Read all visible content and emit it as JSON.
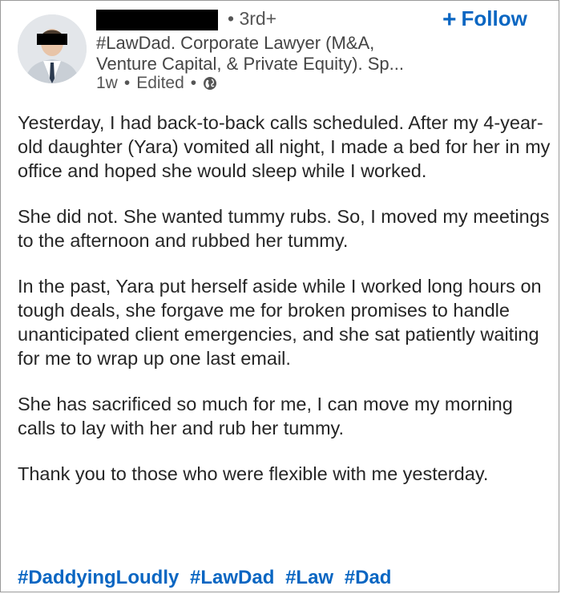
{
  "post": {
    "degree": "• 3rd+",
    "follow_label": "Follow",
    "headline_line1": "#LawDad. Corporate Lawyer (M&A,",
    "headline_line2": "Venture Capital, & Private Equity). Sp...",
    "time": "1w",
    "edited": "Edited",
    "paragraphs": [
      "Yesterday, I had back-to-back calls scheduled. After my 4-year-old daughter (Yara) vomited all night, I made a bed for her in my office and hoped she would sleep while I worked.",
      "She did not. She wanted tummy rubs. So, I moved my meetings to the afternoon and rubbed her tummy.",
      "In the past, Yara put herself aside while I worked long hours on tough deals, she forgave me for broken promises to handle unanticipated client emergencies, and she sat patiently waiting for me to wrap up one last email.",
      "She has sacrificed so much for me, I can move my morning calls to lay with her and rub her tummy.",
      "Thank you to those who were flexible with me yesterday."
    ],
    "hashtags": [
      "#DaddyingLoudly",
      "#LawDad",
      "#Law",
      "#Dad"
    ]
  },
  "colors": {
    "link": "#0a66c2",
    "text": "#262626"
  },
  "icons": {
    "visibility": "globe-icon",
    "follow": "plus-icon"
  }
}
